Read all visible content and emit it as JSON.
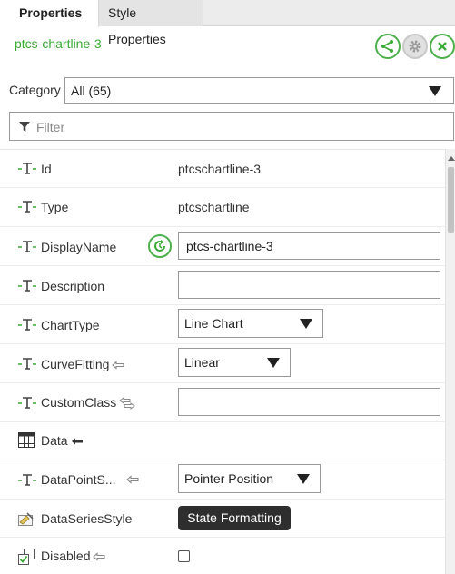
{
  "tabs": [
    {
      "label": "Properties",
      "active": true
    },
    {
      "label": "Style Properties",
      "active": false
    }
  ],
  "widget": {
    "name": "ptcs-chartline-3"
  },
  "toolbar": [
    {
      "icon": "share-icon"
    },
    {
      "icon": "gear-icon"
    },
    {
      "icon": "close-icon"
    }
  ],
  "category": {
    "label": "Category",
    "value": "All (65)"
  },
  "filter": {
    "placeholder": "Filter"
  },
  "properties": [
    {
      "name": "Id",
      "value": "ptcschartline-3",
      "icon": "string-type-icon",
      "editor": "text"
    },
    {
      "name": "Type",
      "value": "ptcschartline",
      "icon": "string-type-icon",
      "editor": "text"
    },
    {
      "name": "DisplayName",
      "value": "ptcs-chartline-3",
      "icon": "string-type-icon",
      "editor": "input"
    },
    {
      "name": "Description",
      "value": "",
      "icon": "string-type-icon",
      "editor": "input"
    },
    {
      "name": "ChartType",
      "value": "Line Chart",
      "icon": "string-type-icon",
      "editor": "dropdown"
    },
    {
      "name": "CurveFitting",
      "value": "Linear",
      "icon": "string-type-icon",
      "editor": "dropdown",
      "binding": "bind-target-icon"
    },
    {
      "name": "CustomClass",
      "value": "",
      "icon": "string-type-icon",
      "editor": "input",
      "binding": "bind-both-icon"
    },
    {
      "name": "Data",
      "value": "",
      "icon": "infotable-icon",
      "editor": "none",
      "binding": "bind-target-filled-icon"
    },
    {
      "name": "DataPointS...",
      "value": "Pointer Position",
      "icon": "string-type-icon",
      "editor": "dropdown",
      "binding": "bind-target-icon"
    },
    {
      "name": "DataSeriesStyle",
      "value": "State Formatting",
      "icon": "style-definition-icon",
      "editor": "button"
    },
    {
      "name": "Disabled",
      "value": "",
      "icon": "boolean-icon",
      "editor": "checkbox",
      "binding": "bind-target-icon"
    }
  ],
  "colors": {
    "accent": "#3aaa35",
    "dark_button": "#2e2e2e"
  }
}
